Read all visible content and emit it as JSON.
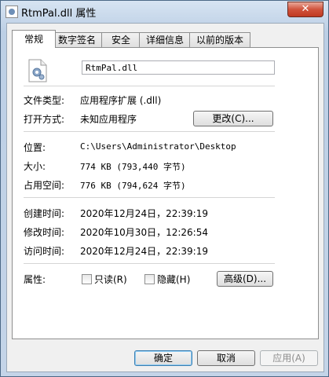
{
  "window": {
    "title": "RtmPal.dll 属性",
    "close_label": "✕"
  },
  "tabs": [
    "常规",
    "数字签名",
    "安全",
    "详细信息",
    "以前的版本"
  ],
  "general": {
    "file_name": "RtmPal.dll",
    "file_type_label": "文件类型:",
    "file_type_value": "应用程序扩展 (.dll)",
    "opens_with_label": "打开方式:",
    "opens_with_value": "未知应用程序",
    "change_button": "更改(C)...",
    "location_label": "位置:",
    "location_value": "C:\\Users\\Administrator\\Desktop",
    "size_label": "大小:",
    "size_value": "774 KB (793,440 字节)",
    "size_on_disk_label": "占用空间:",
    "size_on_disk_value": "776 KB (794,624 字节)",
    "created_label": "创建时间:",
    "created_value": "2020年12月24日，22:39:19",
    "modified_label": "修改时间:",
    "modified_value": "2020年10月30日，12:26:54",
    "accessed_label": "访问时间:",
    "accessed_value": "2020年12月24日，22:39:19",
    "attributes_label": "属性:",
    "readonly_label": "只读(R)",
    "readonly_checked": false,
    "hidden_label": "隐藏(H)",
    "hidden_checked": false,
    "advanced_button": "高级(D)..."
  },
  "footer": {
    "ok_button": "确定",
    "cancel_button": "取消",
    "apply_button": "应用(A)"
  }
}
